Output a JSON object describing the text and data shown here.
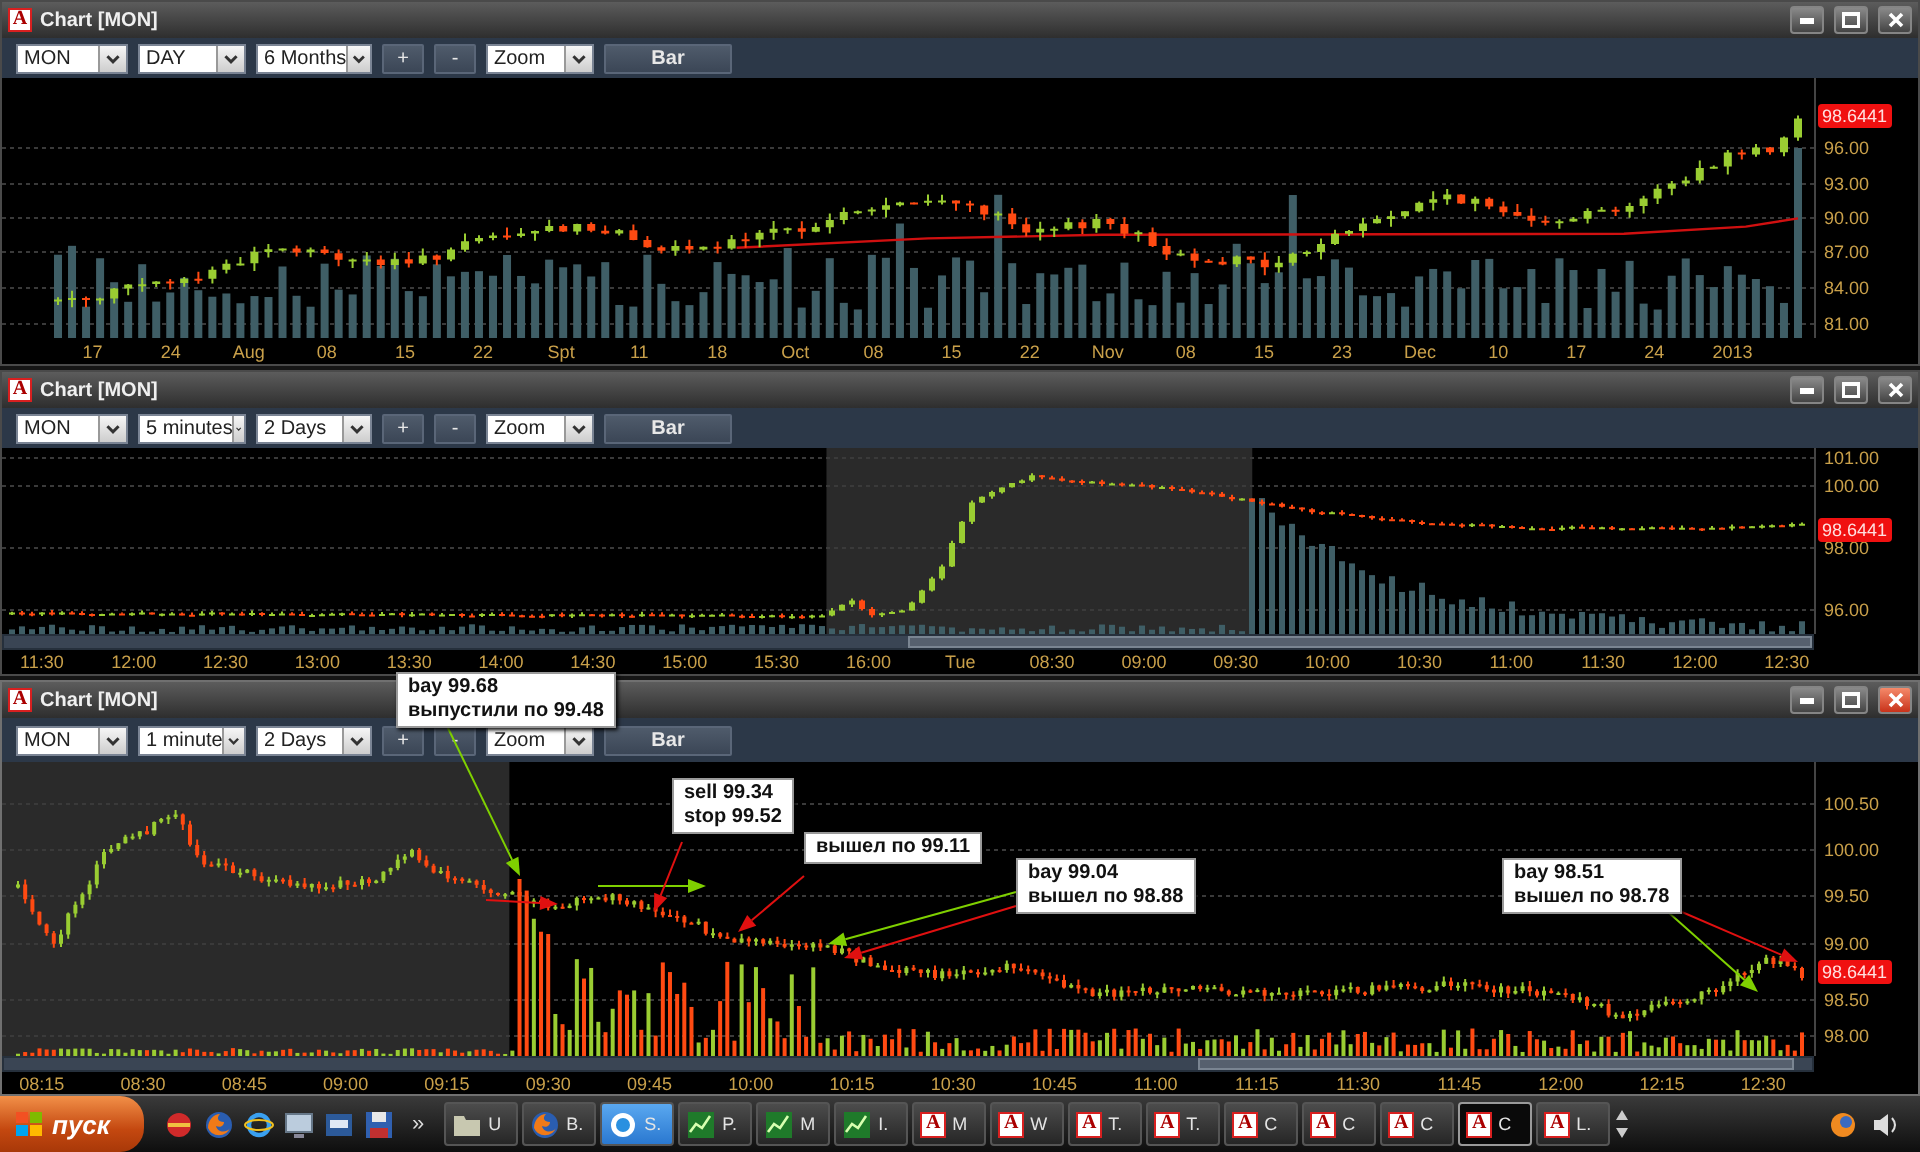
{
  "windows": [
    {
      "badge": "A",
      "title": "Chart [MON]",
      "active": false,
      "has_scrollbar": false,
      "toolbar": {
        "symbol": "MON",
        "interval": "DAY",
        "range": "6 Months",
        "zoom_in": "+",
        "zoom_out": "-",
        "mode": "Zoom",
        "chart_type": "Bar"
      },
      "price_axis": [
        "96.00",
        "93.00",
        "90.00",
        "87.00",
        "84.00",
        "81.00"
      ],
      "last_price": "98.6441",
      "time_axis": [
        "17",
        "24",
        "Aug",
        "08",
        "15",
        "22",
        "Spt",
        "11",
        "18",
        "Oct",
        "08",
        "15",
        "22",
        "Nov",
        "08",
        "15",
        "23",
        "Dec",
        "10",
        "17",
        "24",
        "2013"
      ]
    },
    {
      "badge": "A",
      "title": "Chart [MON]",
      "active": false,
      "has_scrollbar": true,
      "toolbar": {
        "symbol": "MON",
        "interval": "5 minutes",
        "range": "2 Days",
        "zoom_in": "+",
        "zoom_out": "-",
        "mode": "Zoom",
        "chart_type": "Bar"
      },
      "price_axis": [
        "101.00",
        "100.00",
        "98.00",
        "96.00"
      ],
      "last_price": "98.6441",
      "time_axis": [
        "11:30",
        "12:00",
        "12:30",
        "13:00",
        "13:30",
        "14:00",
        "14:30",
        "15:00",
        "15:30",
        "16:00",
        "Tue",
        "08:30",
        "09:00",
        "09:30",
        "10:00",
        "10:30",
        "11:00",
        "11:30",
        "12:00",
        "12:30"
      ]
    },
    {
      "badge": "A",
      "title": "Chart [MON]",
      "active": true,
      "has_scrollbar": true,
      "toolbar": {
        "symbol": "MON",
        "interval": "1 minute",
        "range": "2 Days",
        "zoom_in": "+",
        "zoom_out": "-",
        "mode": "Zoom",
        "chart_type": "Bar"
      },
      "price_axis": [
        "100.50",
        "100.00",
        "99.50",
        "99.00",
        "98.50",
        "98.00"
      ],
      "last_price": "98.6441",
      "time_axis": [
        "08:15",
        "08:30",
        "08:45",
        "09:00",
        "09:15",
        "09:30",
        "09:45",
        "10:00",
        "10:15",
        "10:30",
        "10:45",
        "11:00",
        "11:15",
        "11:30",
        "11:45",
        "12:00",
        "12:15",
        "12:30"
      ],
      "annotations": [
        {
          "lines": [
            "bay 99.68",
            "выпустили по 99.48"
          ]
        },
        {
          "lines": [
            "sell 99.34",
            "stop 99.52"
          ]
        },
        {
          "lines": [
            "вышел по 99.11"
          ]
        },
        {
          "lines": [
            "bay 99.04",
            "вышел по 98.88"
          ]
        },
        {
          "lines": [
            "bay 98.51",
            "вышел по 98.78"
          ]
        }
      ]
    }
  ],
  "taskbar": {
    "start": "пуск",
    "more": "»",
    "tasks": [
      {
        "kind": "folder",
        "label": "U",
        "selected": false,
        "flashing": false
      },
      {
        "kind": "firefox",
        "label": "B.",
        "selected": false,
        "flashing": false
      },
      {
        "kind": "skype",
        "label": "S.",
        "selected": false,
        "flashing": true
      },
      {
        "kind": "stock",
        "label": "P.",
        "selected": false,
        "flashing": false
      },
      {
        "kind": "stock",
        "label": "M",
        "selected": false,
        "flashing": false
      },
      {
        "kind": "stock",
        "label": "I.",
        "selected": false,
        "flashing": false
      },
      {
        "kind": "chart",
        "badge": "A",
        "label": "M",
        "selected": false,
        "flashing": false
      },
      {
        "kind": "chart",
        "badge": "A",
        "label": "W",
        "selected": false,
        "flashing": false
      },
      {
        "kind": "chart",
        "badge": "A",
        "label": "T.",
        "selected": false,
        "flashing": false
      },
      {
        "kind": "chart",
        "badge": "A",
        "label": "T.",
        "selected": false,
        "flashing": false
      },
      {
        "kind": "chart",
        "badge": "A",
        "label": "C",
        "selected": false,
        "flashing": false
      },
      {
        "kind": "chart",
        "badge": "A",
        "label": "C",
        "selected": false,
        "flashing": false
      },
      {
        "kind": "chart",
        "badge": "A",
        "label": "C",
        "selected": false,
        "flashing": false
      },
      {
        "kind": "chart",
        "badge": "A",
        "label": "C",
        "selected": true,
        "flashing": false
      },
      {
        "kind": "chart",
        "badge": "A",
        "label": "L.",
        "selected": false,
        "flashing": false
      }
    ]
  }
}
